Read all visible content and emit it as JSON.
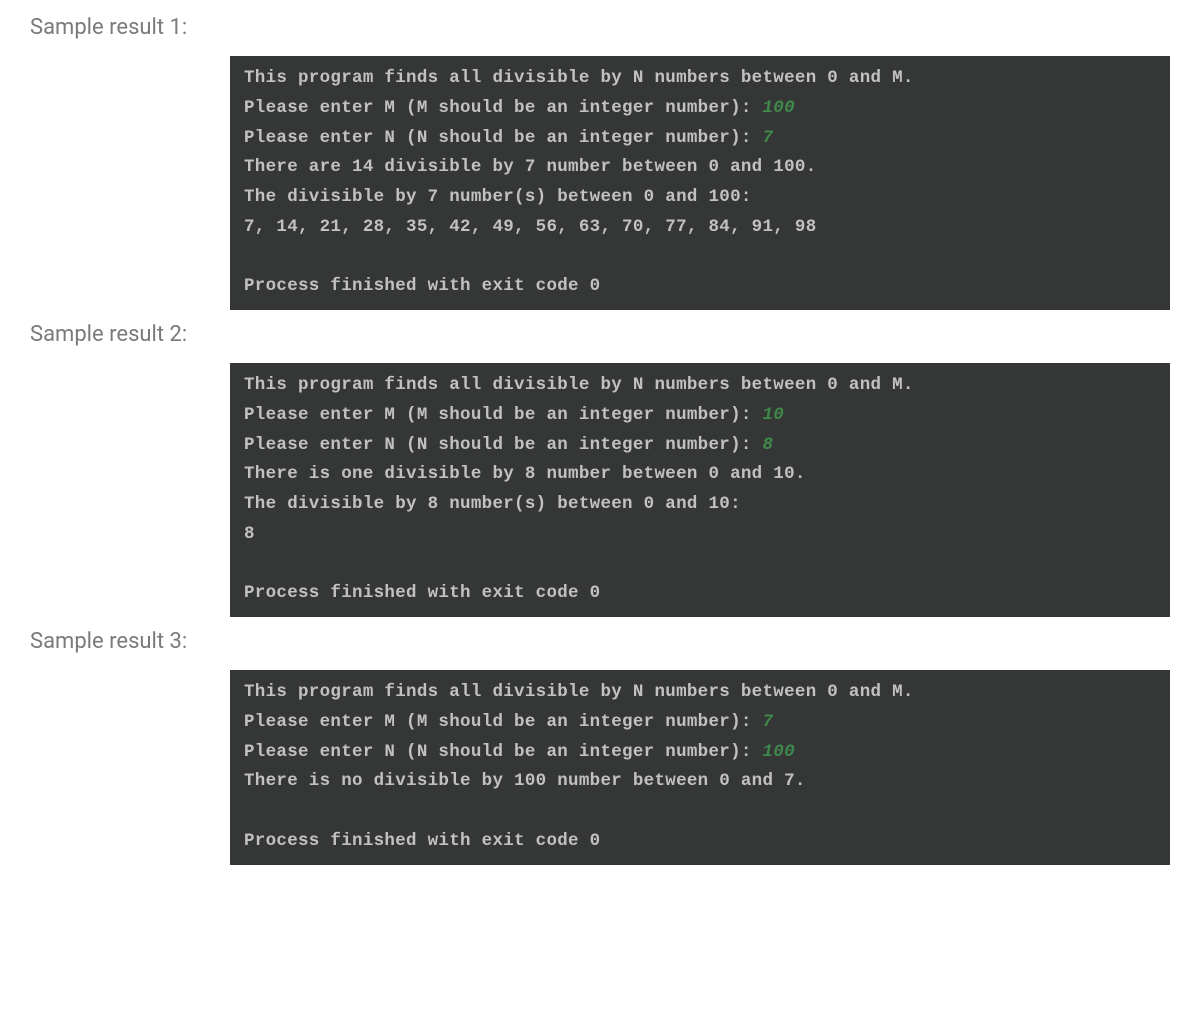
{
  "samples": [
    {
      "label": "Sample result 1:",
      "terminal": {
        "program_line": "This program finds all divisible by N numbers between 0 and M.",
        "prompt_m": "Please enter M (M should be an integer number): ",
        "input_m": "100",
        "prompt_n": "Please enter N (N should be an integer number): ",
        "input_n": "7",
        "count_line": "There are 14 divisible by 7 number between 0 and 100.",
        "list_header": "The divisible by 7 number(s) between 0 and 100:",
        "numbers": "7, 14, 21, 28, 35, 42, 49, 56, 63, 70, 77, 84, 91, 98",
        "exit_line": "Process finished with exit code 0"
      }
    },
    {
      "label": "Sample result 2:",
      "terminal": {
        "program_line": "This program finds all divisible by N numbers between 0 and M.",
        "prompt_m": "Please enter M (M should be an integer number): ",
        "input_m": "10",
        "prompt_n": "Please enter N (N should be an integer number): ",
        "input_n": "8",
        "count_line": "There is one divisible by 8 number between 0 and 10.",
        "list_header": "The divisible by 8 number(s) between 0 and 10:",
        "numbers": "8",
        "exit_line": "Process finished with exit code 0"
      }
    },
    {
      "label": "Sample result 3:",
      "terminal": {
        "program_line": "This program finds all divisible by N numbers between 0 and M.",
        "prompt_m": "Please enter M (M should be an integer number): ",
        "input_m": "7",
        "prompt_n": "Please enter N (N should be an integer number): ",
        "input_n": "100",
        "count_line": "There is no divisible by 100 number between 0 and 7.",
        "list_header": "",
        "numbers": "",
        "exit_line": "Process finished with exit code 0"
      }
    }
  ]
}
